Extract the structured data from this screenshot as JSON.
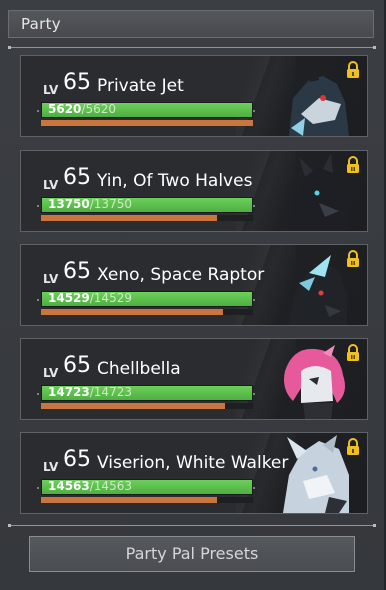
{
  "header": {
    "title": "Party"
  },
  "party": [
    {
      "lv_label": "LV",
      "level": "65",
      "name": "Private Jet",
      "hp": "5620",
      "hp_max": "/5620",
      "hp_fraction": 1.0,
      "stamina_fraction": 1.0,
      "locked": true
    },
    {
      "lv_label": "LV",
      "level": "65",
      "name": "Yin, Of Two Halves",
      "hp": "13750",
      "hp_max": "/13750",
      "hp_fraction": 1.0,
      "stamina_fraction": 0.83,
      "locked": true
    },
    {
      "lv_label": "LV",
      "level": "65",
      "name": "Xeno, Space Raptor",
      "hp": "14529",
      "hp_max": "/14529",
      "hp_fraction": 1.0,
      "stamina_fraction": 0.86,
      "locked": true
    },
    {
      "lv_label": "LV",
      "level": "65",
      "name": "Chellbella",
      "hp": "14723",
      "hp_max": "/14723",
      "hp_fraction": 1.0,
      "stamina_fraction": 0.87,
      "locked": true
    },
    {
      "lv_label": "LV",
      "level": "65",
      "name": "Viserion, White Walker",
      "hp": "14563",
      "hp_max": "/14563",
      "hp_fraction": 1.0,
      "stamina_fraction": 0.83,
      "locked": true
    }
  ],
  "presets_button": {
    "label": "Party Pal Presets"
  },
  "colors": {
    "hp": "#5bbf4a",
    "stamina": "#c9753e",
    "lock": "#f0c020"
  },
  "icons": {
    "lock": "padlock-icon"
  }
}
